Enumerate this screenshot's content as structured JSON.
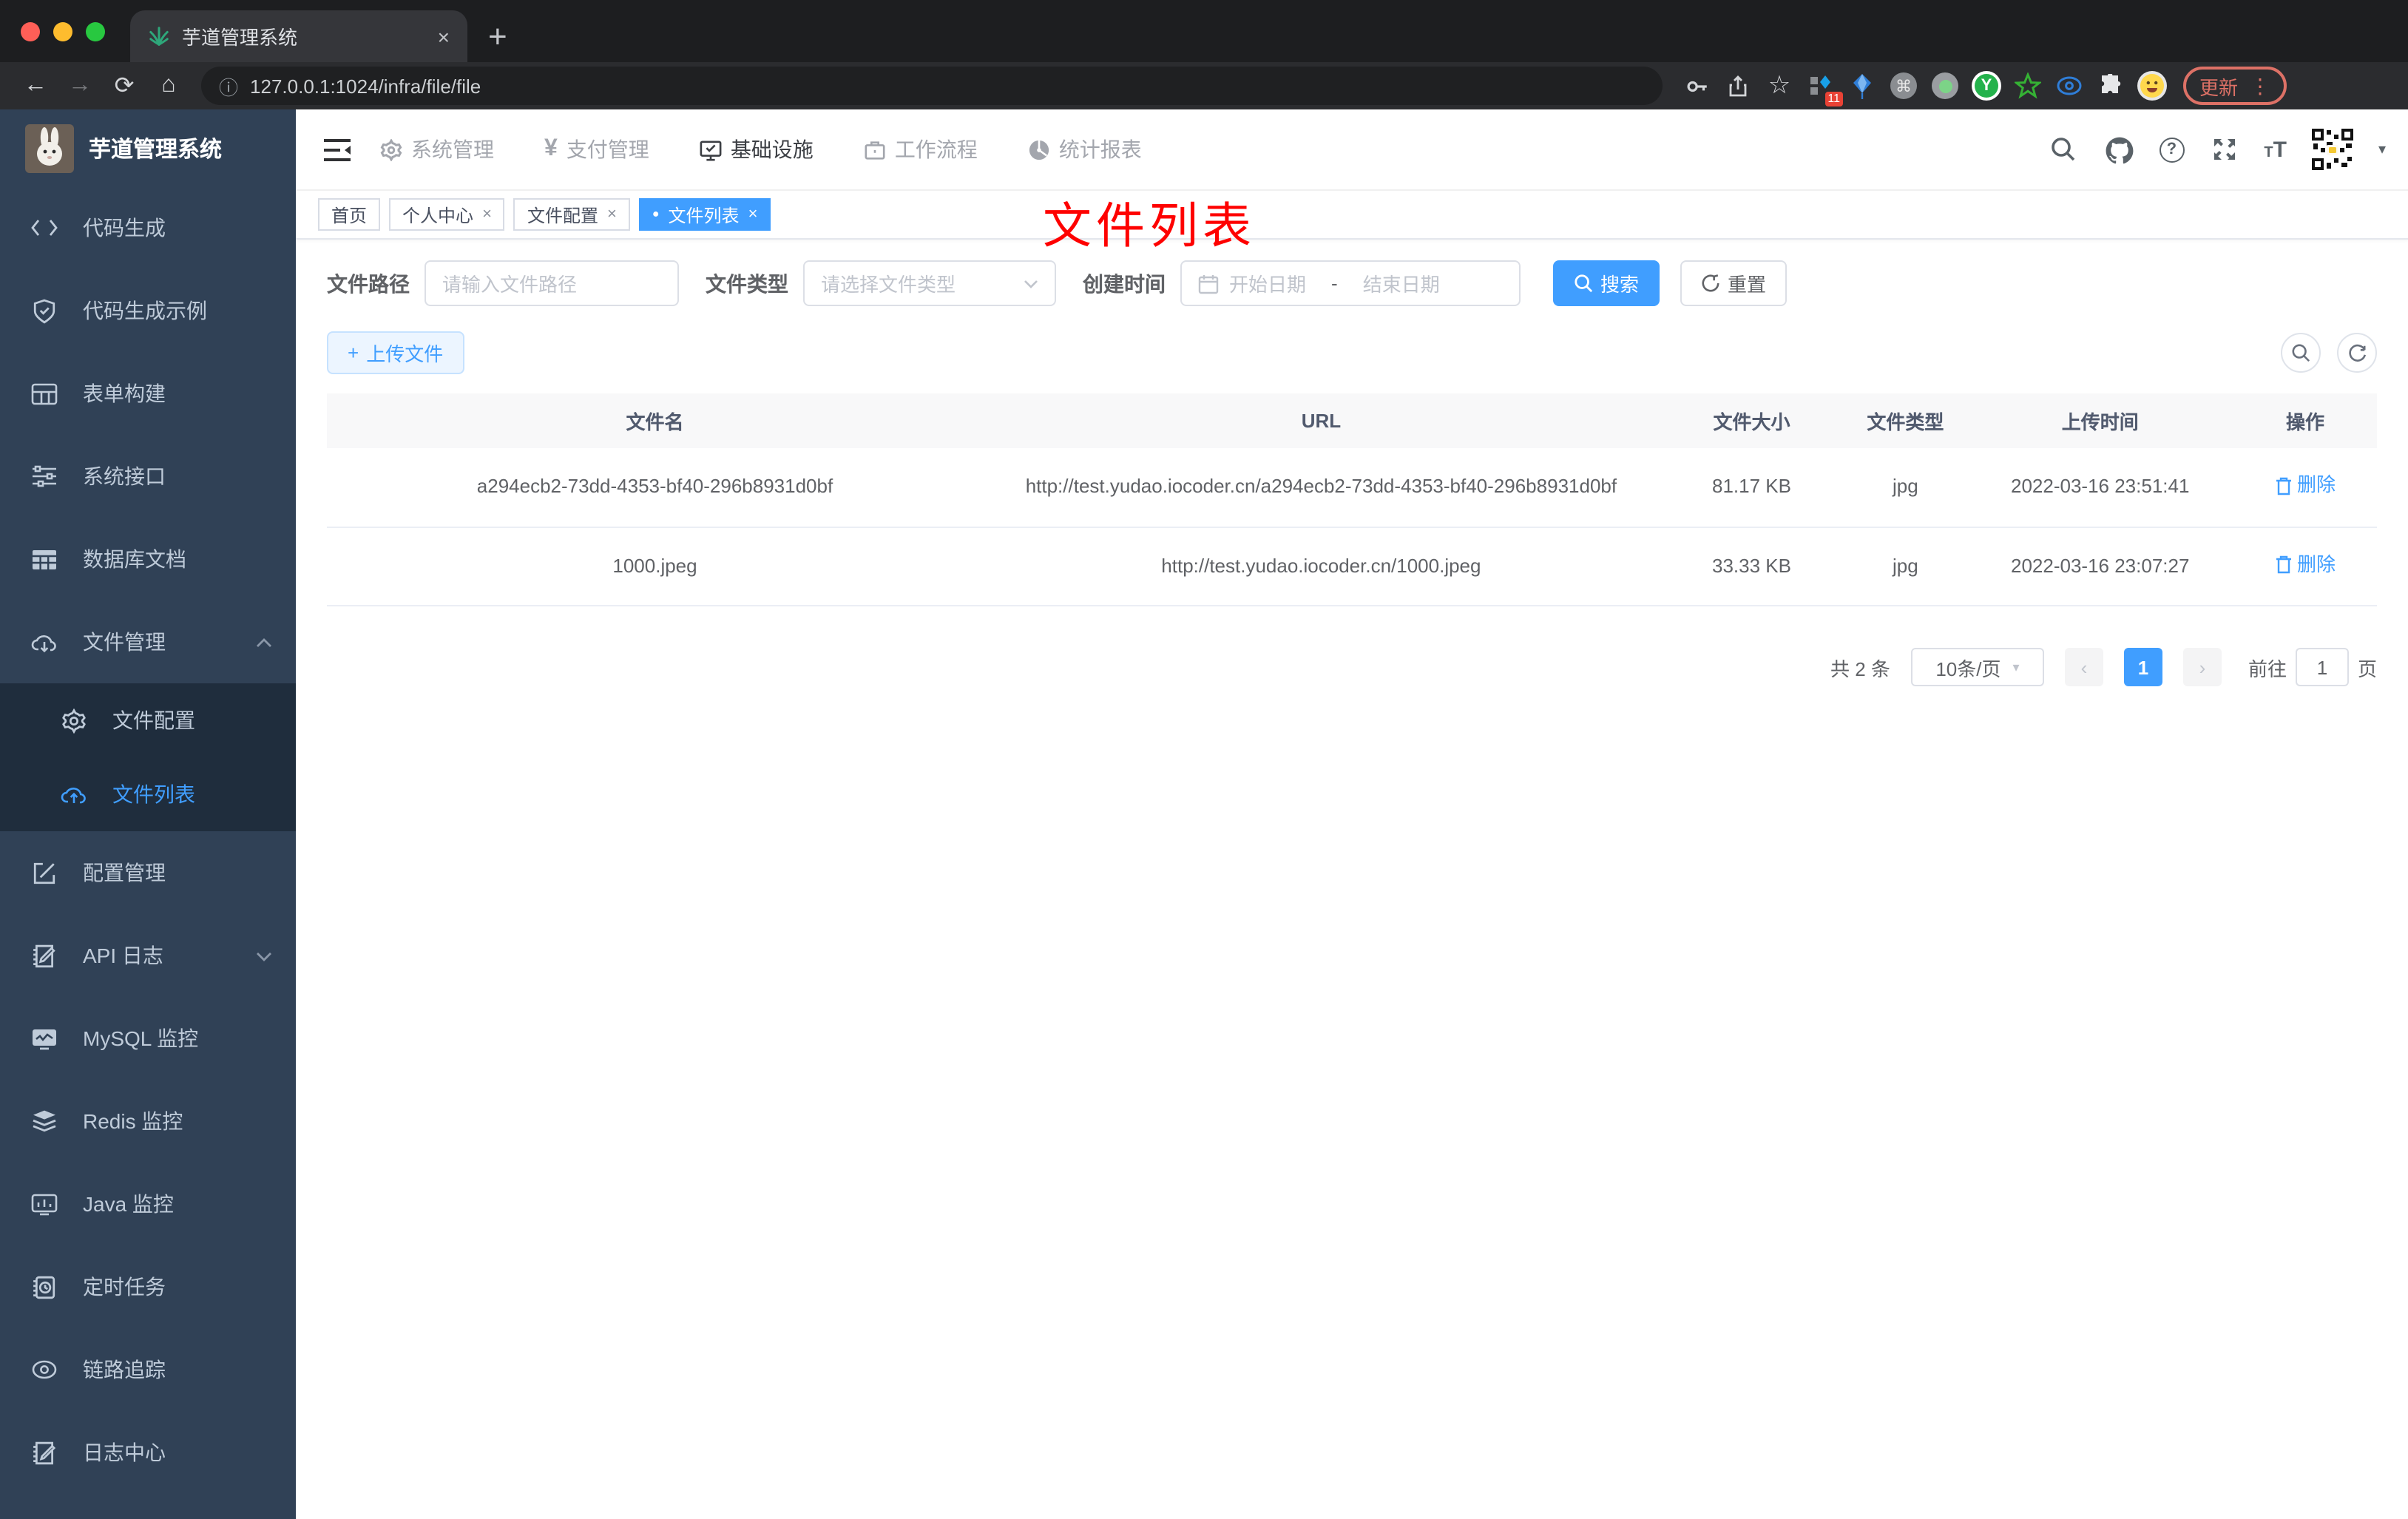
{
  "glyphs": {
    "back": "←",
    "forward": "→",
    "reload": "⟳",
    "home": "⌂",
    "info": "ⓘ",
    "star": "☆",
    "command": "⌘",
    "caret_down": "▾",
    "close": "×",
    "dot": "●",
    "plus": "+",
    "dash": "-",
    "yen": "¥",
    "dots_vertical": "⋮",
    "prev": "‹",
    "next": "›",
    "font_small": "T",
    "font_big": "T",
    "question": "?",
    "newtab": "+"
  },
  "browser": {
    "tab_title": "芋道管理系统",
    "url": "127.0.0.1:1024/infra/file/file",
    "extension_badge": "11",
    "update_label": "更新",
    "ycircle_letter": "Y"
  },
  "app": {
    "title": "芋道管理系统",
    "top_nav": [
      {
        "label": "系统管理"
      },
      {
        "label": "支付管理"
      },
      {
        "label": "基础设施"
      },
      {
        "label": "工作流程"
      },
      {
        "label": "统计报表"
      }
    ],
    "sidebar": {
      "items": [
        {
          "label": "代码生成"
        },
        {
          "label": "代码生成示例"
        },
        {
          "label": "表单构建"
        },
        {
          "label": "系统接口"
        },
        {
          "label": "数据库文档"
        },
        {
          "label": "文件管理"
        },
        {
          "label": "文件配置"
        },
        {
          "label": "文件列表"
        },
        {
          "label": "配置管理"
        },
        {
          "label": "API 日志"
        },
        {
          "label": "MySQL 监控"
        },
        {
          "label": "Redis 监控"
        },
        {
          "label": "Java 监控"
        },
        {
          "label": "定时任务"
        },
        {
          "label": "链路追踪"
        },
        {
          "label": "日志中心"
        }
      ]
    },
    "tabs": [
      {
        "label": "首页"
      },
      {
        "label": "个人中心"
      },
      {
        "label": "文件配置"
      },
      {
        "label": "文件列表"
      }
    ],
    "annotation": "文件列表",
    "filters": {
      "path_label": "文件路径",
      "path_placeholder": "请输入文件路径",
      "type_label": "文件类型",
      "type_placeholder": "请选择文件类型",
      "date_label": "创建时间",
      "date_start_placeholder": "开始日期",
      "date_end_placeholder": "结束日期",
      "search_label": "搜索",
      "reset_label": "重置"
    },
    "toolbar": {
      "upload_label": "上传文件"
    },
    "table": {
      "columns": [
        "文件名",
        "URL",
        "文件大小",
        "文件类型",
        "上传时间",
        "操作"
      ],
      "delete_label": "删除",
      "rows": [
        {
          "name": "a294ecb2-73dd-4353-bf40-296b8931d0bf",
          "url": "http://test.yudao.iocoder.cn/a294ecb2-73dd-4353-bf40-296b8931d0bf",
          "size": "81.17 KB",
          "type": "jpg",
          "time": "2022-03-16 23:51:41"
        },
        {
          "name": "1000.jpeg",
          "url": "http://test.yudao.iocoder.cn/1000.jpeg",
          "size": "33.33 KB",
          "type": "jpg",
          "time": "2022-03-16 23:07:27"
        }
      ]
    },
    "pagination": {
      "total": "共 2 条",
      "per_page": "10条/页",
      "page": "1",
      "goto_prefix": "前往",
      "goto_suffix": "页",
      "goto_value": "1"
    }
  }
}
